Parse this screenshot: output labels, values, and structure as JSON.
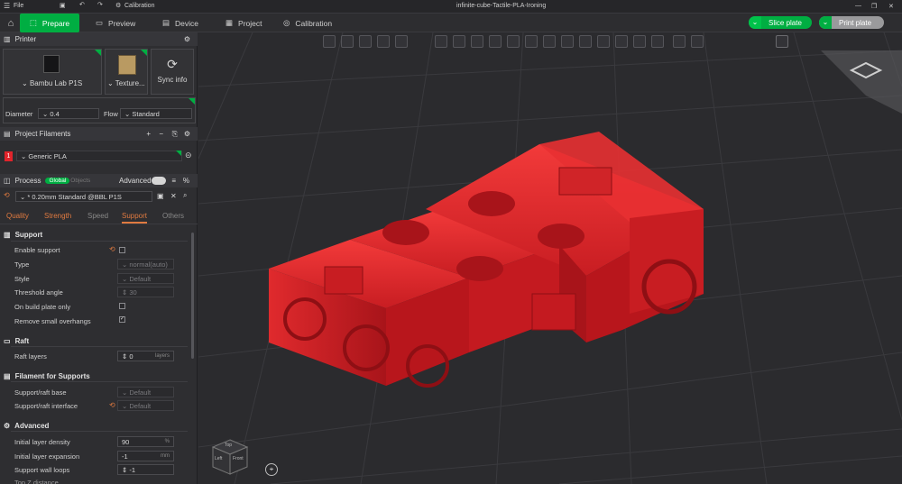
{
  "titlebar": {
    "file": "File",
    "calibration": "Calibration",
    "filename": "infinite-cube-Tactile-PLA-Ironing"
  },
  "tabs": {
    "prepare": "Prepare",
    "preview": "Preview",
    "device": "Device",
    "project": "Project",
    "calibration": "Calibration"
  },
  "actions": {
    "slice": "Slice plate",
    "print": "Print plate"
  },
  "printer": {
    "header": "Printer",
    "name": "Bambu Lab P1S",
    "plate": "Texture...",
    "sync": "Sync info",
    "diameter_label": "Diameter",
    "diameter": "0.4",
    "flow_label": "Flow",
    "flow": "Standard"
  },
  "filaments": {
    "header": "Project Filaments",
    "items": [
      {
        "index": "1",
        "name": "Generic PLA",
        "color": "#e0242b"
      }
    ]
  },
  "process": {
    "header": "Process",
    "global": "Global",
    "objects": "Objects",
    "advanced": "Advanced",
    "preset": "* 0.20mm Standard @BBL P1S",
    "tabs": [
      "Quality",
      "Strength",
      "Speed",
      "Support",
      "Others"
    ],
    "active_tab": "Support"
  },
  "support": {
    "title": "Support",
    "rows": [
      {
        "label": "Enable support",
        "kind": "check",
        "checked": false
      },
      {
        "label": "Type",
        "kind": "select",
        "value": "normal(auto)",
        "dim": true
      },
      {
        "label": "Style",
        "kind": "select",
        "value": "Default",
        "dim": true
      },
      {
        "label": "Threshold angle",
        "kind": "num",
        "value": "30",
        "dim": true
      },
      {
        "label": "On build plate only",
        "kind": "check",
        "checked": false
      },
      {
        "label": "Remove small overhangs",
        "kind": "check",
        "checked": true
      }
    ]
  },
  "raft": {
    "title": "Raft",
    "layers_label": "Raft layers",
    "layers": "0",
    "unit": "layers"
  },
  "filament_supports": {
    "title": "Filament for Supports",
    "base_label": "Support/raft base",
    "base": "Default",
    "iface_label": "Support/raft interface",
    "iface": "Default"
  },
  "advanced": {
    "title": "Advanced",
    "rows": [
      {
        "label": "Initial layer density",
        "value": "90",
        "unit": "%"
      },
      {
        "label": "Initial layer expansion",
        "value": "-1",
        "unit": "mm"
      },
      {
        "label": "Support wall loops",
        "value": "-1",
        "unit": ""
      },
      {
        "label": "Top Z distance",
        "value": "",
        "unit": ""
      }
    ]
  },
  "navcube": {
    "top": "Top",
    "left": "Left",
    "front": "Front"
  },
  "colors": {
    "accent": "#00ae42",
    "model": "#e0242b"
  }
}
